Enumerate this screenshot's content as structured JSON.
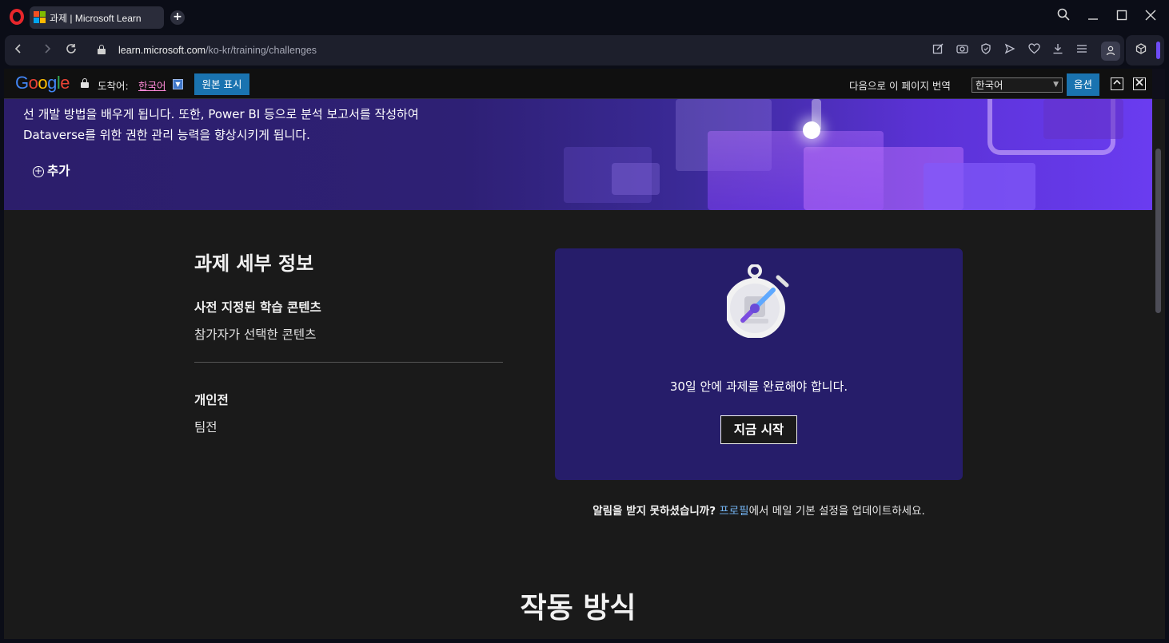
{
  "browser": {
    "tab_title": "과제 | Microsoft Learn",
    "url_host": "learn.microsoft.com",
    "url_path": "/ko-kr/training/challenges",
    "new_tab_label": "+",
    "icons": [
      "search-icon",
      "minimize-icon",
      "maximize-icon",
      "close-icon",
      "back-icon",
      "forward-icon",
      "reload-icon",
      "lock-icon",
      "edit-icon",
      "camera-icon",
      "shield-icon",
      "send-icon",
      "heart-icon",
      "download-icon",
      "menu-icon",
      "profile-icon",
      "extension-icon"
    ]
  },
  "translate_bar": {
    "logo": "Google",
    "translated_to_label": "도착어:",
    "translated_to_lang": "한국어",
    "show_original": "원본 표시",
    "translate_page_label": "다음으로 이 페이지 번역",
    "selected_language": "한국어",
    "options": "옵션"
  },
  "hero": {
    "line1": "선 개발 방법을 배우게 됩니다. 또한, Power BI 등으로 분석 보고서를 작성하여",
    "line2": "Dataverse를 위한 권한 관리 능력을 향상시키게 됩니다.",
    "add_label": "추가"
  },
  "details": {
    "title": "과제 세부 정보",
    "content_heading": "사전 지정된 학습 콘텐츠",
    "content_value": "참가자가 선택한 콘텐츠",
    "mode_heading": "개인전",
    "mode_value": "팀전"
  },
  "card": {
    "message": "30일 안에 과제를 완료해야 합니다.",
    "start_button": "지금 시작"
  },
  "notification": {
    "bold": "알림을 받지 못하셨습니까?",
    "link": "프로필",
    "rest": "에서 메일 기본 설정을 업데이트하세요."
  },
  "how_it_works": {
    "title": "작동 방식"
  },
  "colors": {
    "accent_purple": "#6e4cf6",
    "card_bg": "#261d6a",
    "link_blue": "#75b6f5",
    "translate_blue": "#1a73b0"
  }
}
